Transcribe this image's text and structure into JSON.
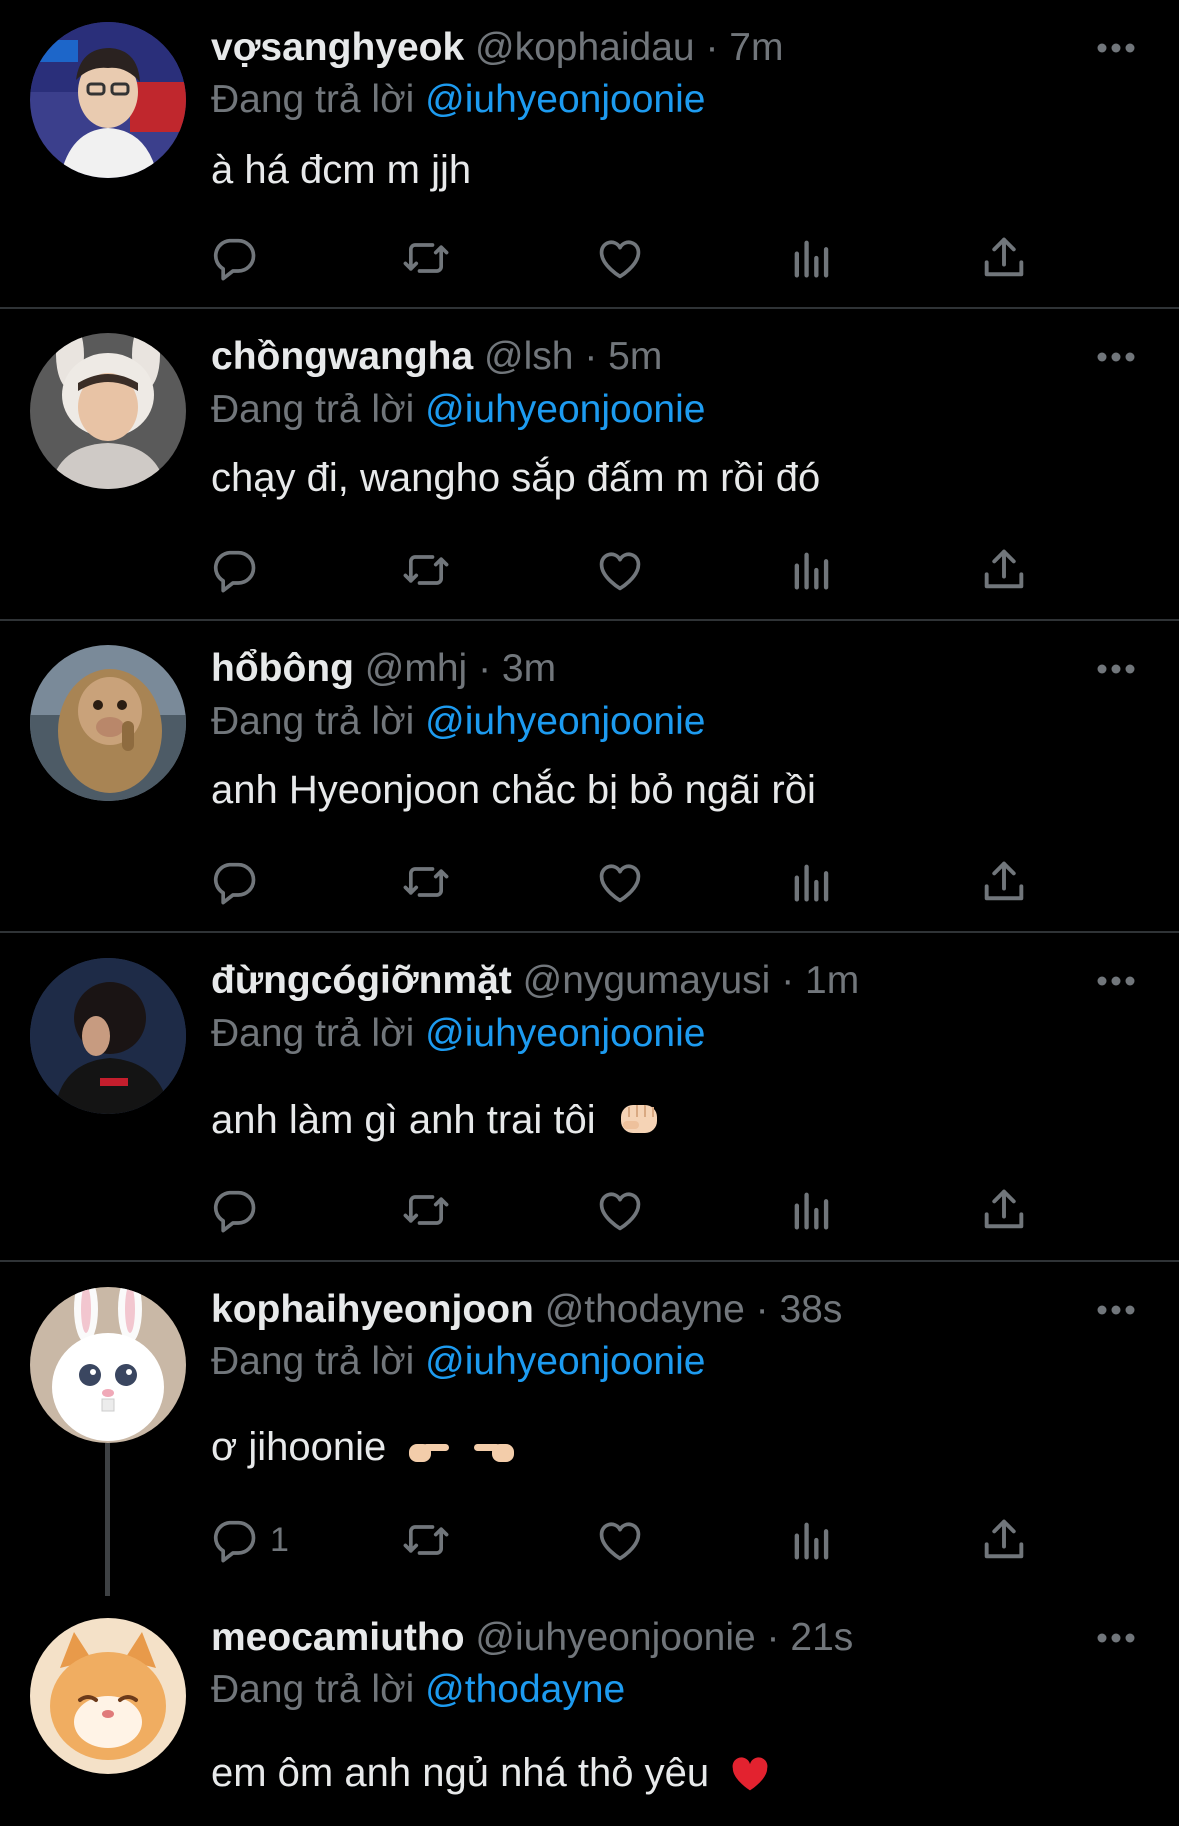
{
  "colors": {
    "background": "#000000",
    "text": "#e7e9ea",
    "muted": "#71767b",
    "link": "#1d9bf0",
    "divider": "#2f3336"
  },
  "reply_prefix": "Đang trả lời",
  "tweets": [
    {
      "name": "vợsanghyeok",
      "handle": "@kophaidau",
      "time": "7m",
      "reply_to": "@iuhyeonjoonie",
      "text": "à há đcm m jjh",
      "reply_count": ""
    },
    {
      "name": "chồngwangha",
      "handle": "@lsh",
      "time": "5m",
      "reply_to": "@iuhyeonjoonie",
      "text": "chạy đi, wangho sắp đấm m rồi đó",
      "reply_count": ""
    },
    {
      "name": "hổbông",
      "handle": "@mhj",
      "time": "3m",
      "reply_to": "@iuhyeonjoonie",
      "text": "anh Hyeonjoon chắc bị bỏ ngãi rồi",
      "reply_count": ""
    },
    {
      "name": "đừngcógiỡnmặt",
      "handle": "@nygumayusi",
      "time": "1m",
      "reply_to": "@iuhyeonjoonie",
      "text": "anh làm gì anh trai tôi",
      "reply_count": ""
    },
    {
      "name": "kophaihyeonjoon",
      "handle": "@thodayne",
      "time": "38s",
      "reply_to": "@iuhyeonjoonie",
      "text": "ơ jihoonie",
      "reply_count": "1"
    },
    {
      "name": "meocamiutho",
      "handle": "@iuhyeonjoonie",
      "time": "21s",
      "reply_to": "@thodayne",
      "text": "em ôm anh ngủ nhá thỏ yêu",
      "reply_count": ""
    }
  ],
  "icons": [
    "more-icon",
    "reply-icon",
    "retweet-icon",
    "like-icon",
    "views-icon",
    "share-icon",
    "fist-emoji",
    "pointing-right-emoji",
    "pointing-left-emoji",
    "heart-emoji"
  ]
}
